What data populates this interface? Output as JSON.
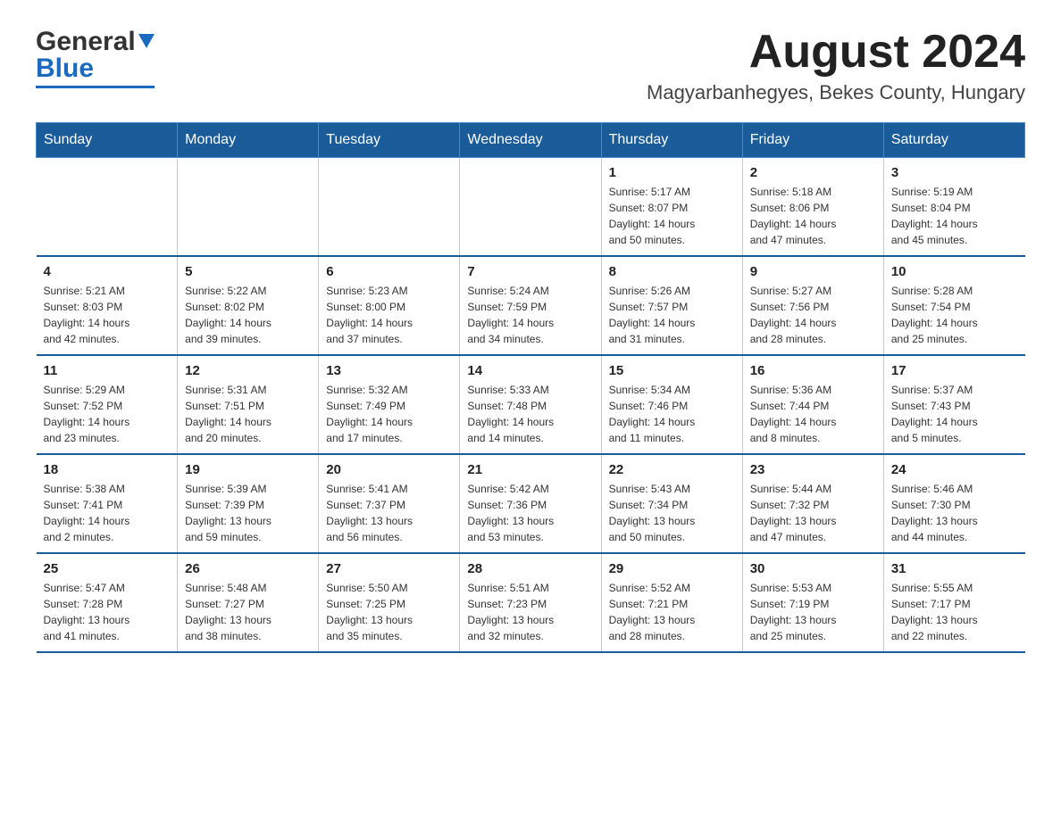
{
  "header": {
    "logo_general": "General",
    "logo_blue": "Blue",
    "month_year": "August 2024",
    "location": "Magyarbanhegyes, Bekes County, Hungary"
  },
  "weekdays": [
    "Sunday",
    "Monday",
    "Tuesday",
    "Wednesday",
    "Thursday",
    "Friday",
    "Saturday"
  ],
  "rows": [
    [
      {
        "day": "",
        "info": ""
      },
      {
        "day": "",
        "info": ""
      },
      {
        "day": "",
        "info": ""
      },
      {
        "day": "",
        "info": ""
      },
      {
        "day": "1",
        "info": "Sunrise: 5:17 AM\nSunset: 8:07 PM\nDaylight: 14 hours\nand 50 minutes."
      },
      {
        "day": "2",
        "info": "Sunrise: 5:18 AM\nSunset: 8:06 PM\nDaylight: 14 hours\nand 47 minutes."
      },
      {
        "day": "3",
        "info": "Sunrise: 5:19 AM\nSunset: 8:04 PM\nDaylight: 14 hours\nand 45 minutes."
      }
    ],
    [
      {
        "day": "4",
        "info": "Sunrise: 5:21 AM\nSunset: 8:03 PM\nDaylight: 14 hours\nand 42 minutes."
      },
      {
        "day": "5",
        "info": "Sunrise: 5:22 AM\nSunset: 8:02 PM\nDaylight: 14 hours\nand 39 minutes."
      },
      {
        "day": "6",
        "info": "Sunrise: 5:23 AM\nSunset: 8:00 PM\nDaylight: 14 hours\nand 37 minutes."
      },
      {
        "day": "7",
        "info": "Sunrise: 5:24 AM\nSunset: 7:59 PM\nDaylight: 14 hours\nand 34 minutes."
      },
      {
        "day": "8",
        "info": "Sunrise: 5:26 AM\nSunset: 7:57 PM\nDaylight: 14 hours\nand 31 minutes."
      },
      {
        "day": "9",
        "info": "Sunrise: 5:27 AM\nSunset: 7:56 PM\nDaylight: 14 hours\nand 28 minutes."
      },
      {
        "day": "10",
        "info": "Sunrise: 5:28 AM\nSunset: 7:54 PM\nDaylight: 14 hours\nand 25 minutes."
      }
    ],
    [
      {
        "day": "11",
        "info": "Sunrise: 5:29 AM\nSunset: 7:52 PM\nDaylight: 14 hours\nand 23 minutes."
      },
      {
        "day": "12",
        "info": "Sunrise: 5:31 AM\nSunset: 7:51 PM\nDaylight: 14 hours\nand 20 minutes."
      },
      {
        "day": "13",
        "info": "Sunrise: 5:32 AM\nSunset: 7:49 PM\nDaylight: 14 hours\nand 17 minutes."
      },
      {
        "day": "14",
        "info": "Sunrise: 5:33 AM\nSunset: 7:48 PM\nDaylight: 14 hours\nand 14 minutes."
      },
      {
        "day": "15",
        "info": "Sunrise: 5:34 AM\nSunset: 7:46 PM\nDaylight: 14 hours\nand 11 minutes."
      },
      {
        "day": "16",
        "info": "Sunrise: 5:36 AM\nSunset: 7:44 PM\nDaylight: 14 hours\nand 8 minutes."
      },
      {
        "day": "17",
        "info": "Sunrise: 5:37 AM\nSunset: 7:43 PM\nDaylight: 14 hours\nand 5 minutes."
      }
    ],
    [
      {
        "day": "18",
        "info": "Sunrise: 5:38 AM\nSunset: 7:41 PM\nDaylight: 14 hours\nand 2 minutes."
      },
      {
        "day": "19",
        "info": "Sunrise: 5:39 AM\nSunset: 7:39 PM\nDaylight: 13 hours\nand 59 minutes."
      },
      {
        "day": "20",
        "info": "Sunrise: 5:41 AM\nSunset: 7:37 PM\nDaylight: 13 hours\nand 56 minutes."
      },
      {
        "day": "21",
        "info": "Sunrise: 5:42 AM\nSunset: 7:36 PM\nDaylight: 13 hours\nand 53 minutes."
      },
      {
        "day": "22",
        "info": "Sunrise: 5:43 AM\nSunset: 7:34 PM\nDaylight: 13 hours\nand 50 minutes."
      },
      {
        "day": "23",
        "info": "Sunrise: 5:44 AM\nSunset: 7:32 PM\nDaylight: 13 hours\nand 47 minutes."
      },
      {
        "day": "24",
        "info": "Sunrise: 5:46 AM\nSunset: 7:30 PM\nDaylight: 13 hours\nand 44 minutes."
      }
    ],
    [
      {
        "day": "25",
        "info": "Sunrise: 5:47 AM\nSunset: 7:28 PM\nDaylight: 13 hours\nand 41 minutes."
      },
      {
        "day": "26",
        "info": "Sunrise: 5:48 AM\nSunset: 7:27 PM\nDaylight: 13 hours\nand 38 minutes."
      },
      {
        "day": "27",
        "info": "Sunrise: 5:50 AM\nSunset: 7:25 PM\nDaylight: 13 hours\nand 35 minutes."
      },
      {
        "day": "28",
        "info": "Sunrise: 5:51 AM\nSunset: 7:23 PM\nDaylight: 13 hours\nand 32 minutes."
      },
      {
        "day": "29",
        "info": "Sunrise: 5:52 AM\nSunset: 7:21 PM\nDaylight: 13 hours\nand 28 minutes."
      },
      {
        "day": "30",
        "info": "Sunrise: 5:53 AM\nSunset: 7:19 PM\nDaylight: 13 hours\nand 25 minutes."
      },
      {
        "day": "31",
        "info": "Sunrise: 5:55 AM\nSunset: 7:17 PM\nDaylight: 13 hours\nand 22 minutes."
      }
    ]
  ]
}
